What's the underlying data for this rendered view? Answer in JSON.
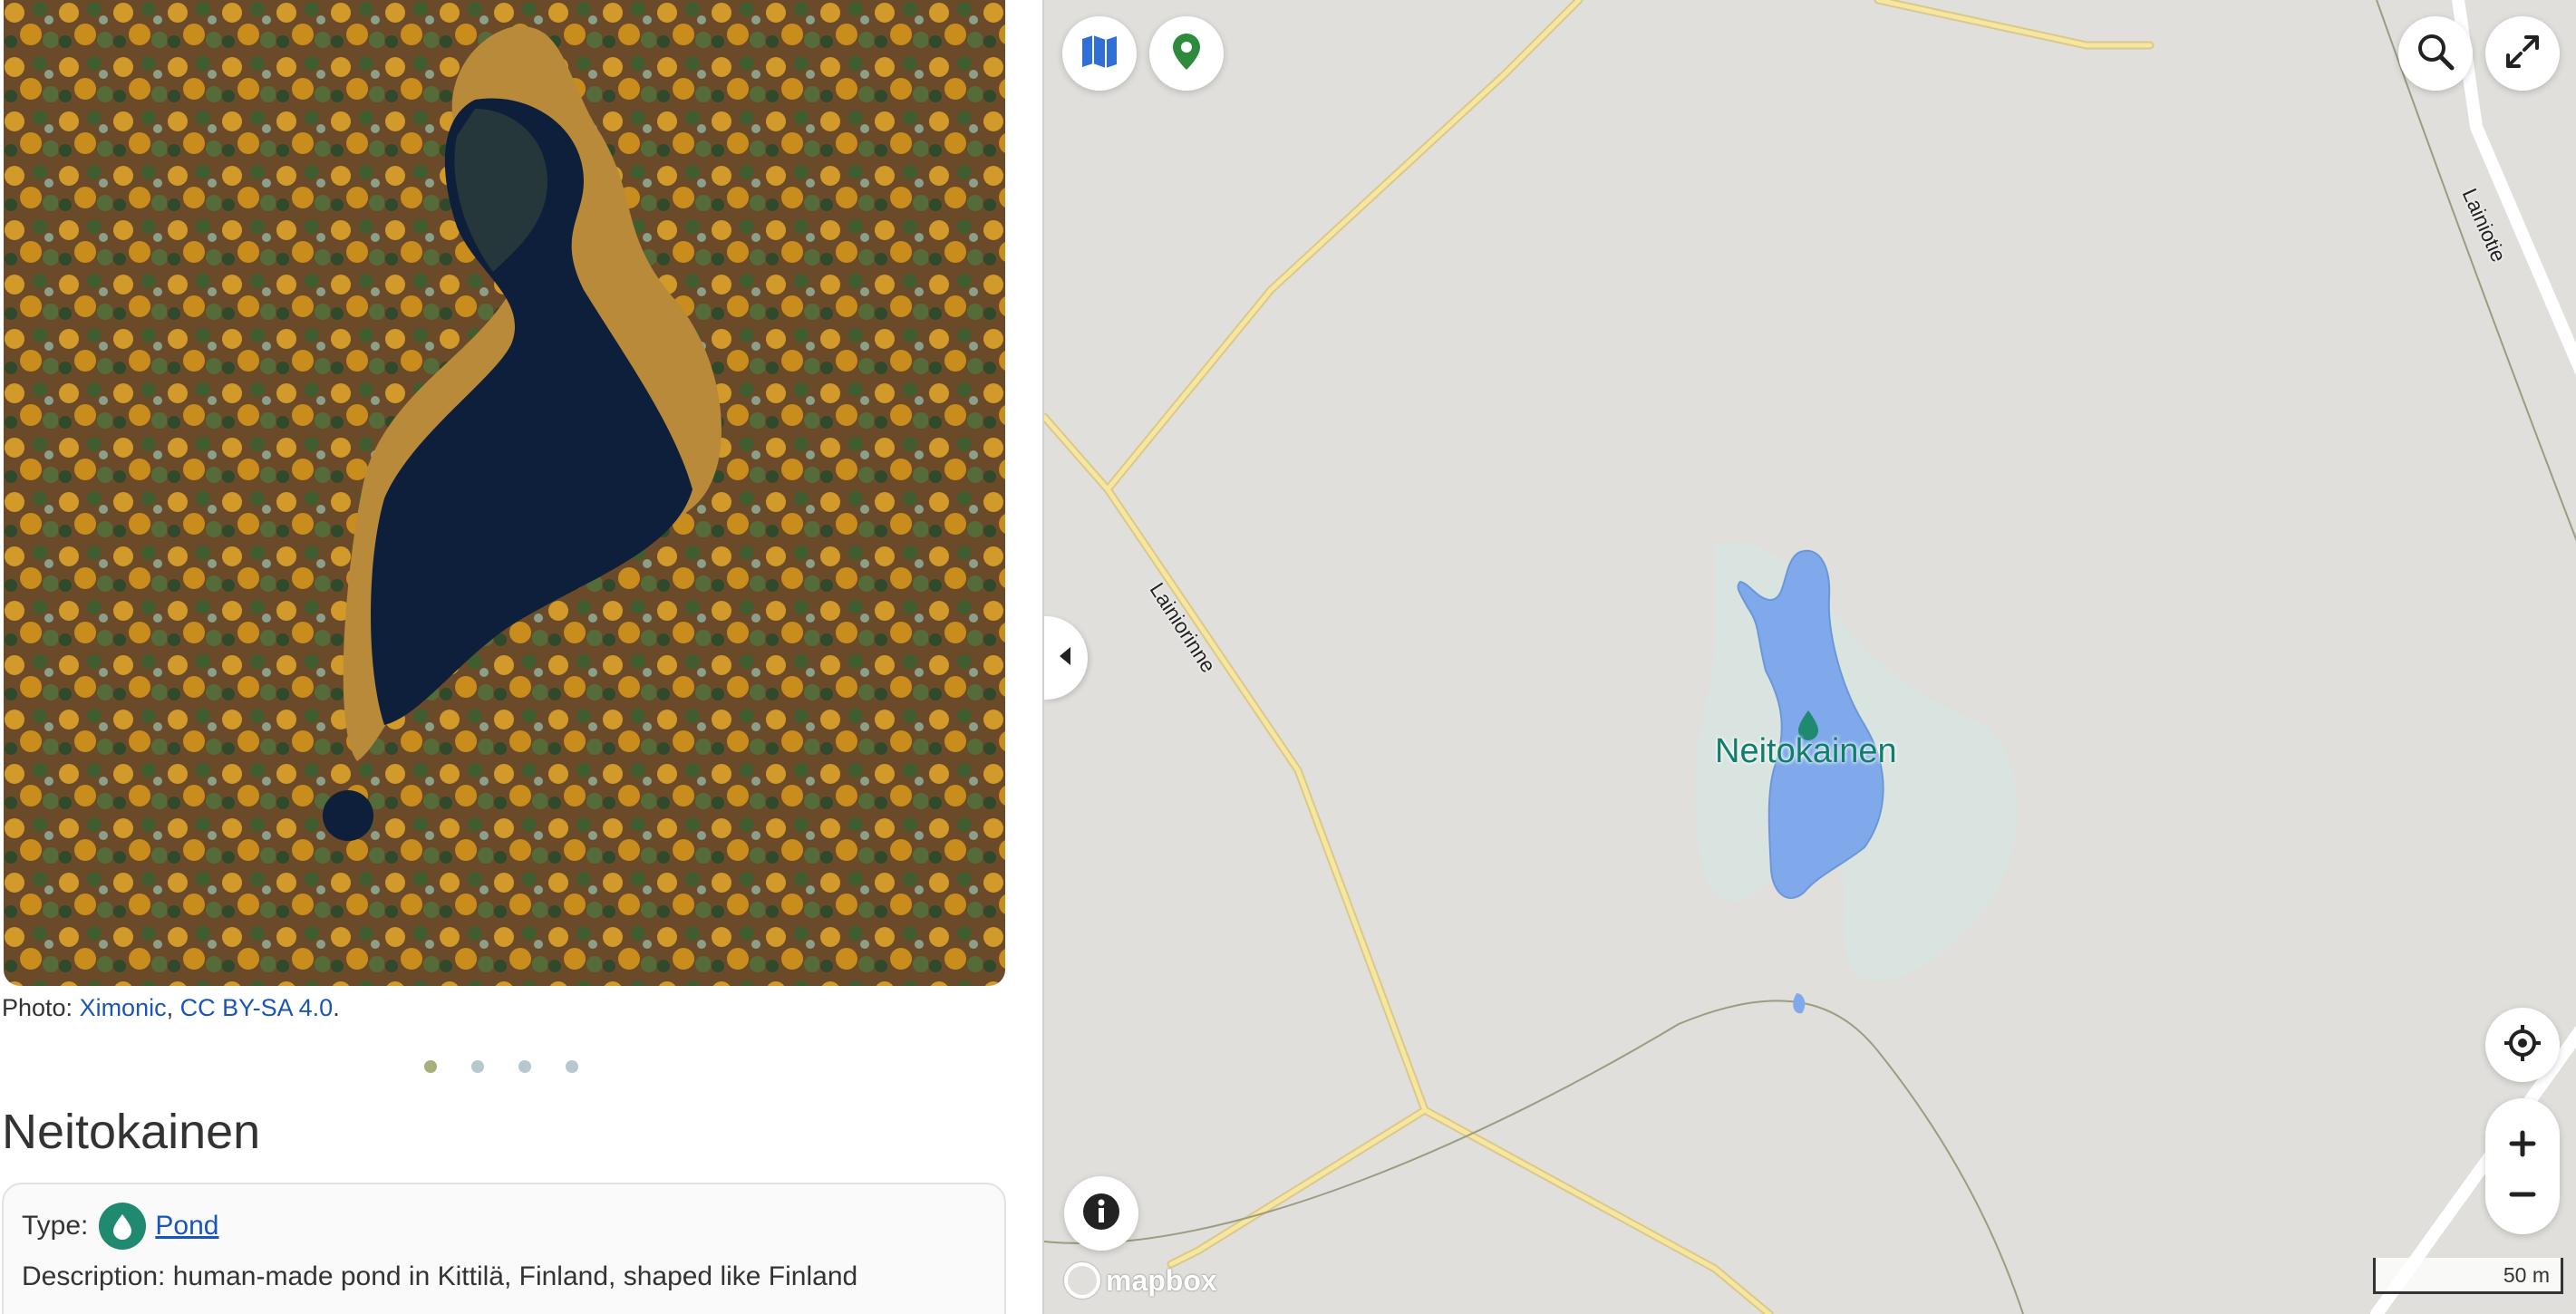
{
  "photo": {
    "credit_prefix": "Photo: ",
    "author": "Ximonic",
    "separator": ", ",
    "license": "CC BY-SA 4.0",
    "suffix": ".",
    "image_icon": "aerial-pond-photo",
    "carousel_count": 4,
    "carousel_active": 1
  },
  "feature": {
    "title": "Neitokainen",
    "type_label": "Type:",
    "type_value": "Pond",
    "type_icon": "water-drop-icon",
    "description_label": "Description:",
    "description_value": "human-made pond in Kittilä, Finland, shaped like Finland"
  },
  "map": {
    "pond_label": "Neitokainen",
    "roads": [
      "Lainiorinne",
      "Lainiotie"
    ],
    "attribution": "mapbox",
    "scale_label": "50 m",
    "buttons": {
      "layers": "map-icon",
      "marker": "location-pin-icon",
      "search": "search-icon",
      "fullscreen": "expand-icon",
      "locate": "geolocate-icon",
      "zoom_in": "plus-icon",
      "zoom_out": "minus-icon",
      "info": "info-icon",
      "collapse": "chevron-left-icon"
    },
    "colors": {
      "background": "#e0dfdc",
      "water": "#7fa9ea",
      "road": "#f6e6a0",
      "pond_label": "#0f7f6b",
      "marker": "#2e8b3e",
      "layers": "#2f6fd6"
    }
  }
}
